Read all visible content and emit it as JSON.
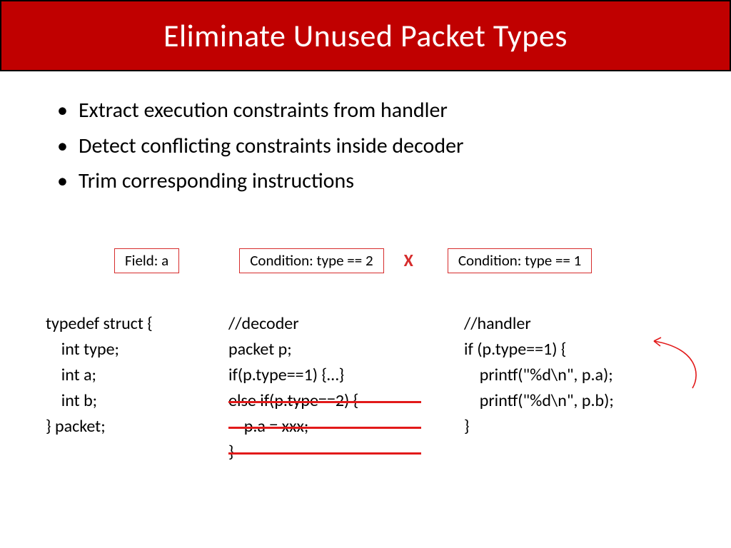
{
  "title": "Eliminate Unused Packet Types",
  "bullets": [
    "Extract execution constraints from handler",
    "Detect conflicting constraints inside decoder",
    "Trim corresponding instructions"
  ],
  "badges": {
    "field": "Field: a",
    "cond2": "Condition: type == 2",
    "x": "X",
    "cond1": "Condition: type == 1"
  },
  "code": {
    "struct": "typedef struct {\n    int type;\n    int a;\n    int b;\n} packet;",
    "decoder": "//decoder\npacket p;\nif(p.type==1) {…}\nelse if(p.type==2) {\n    p.a = xxx;\n}",
    "handler": "//handler\nif (p.type==1) {\n    printf(\"%d\\n\", p.a);\n    printf(\"%d\\n\", p.b);\n}"
  }
}
